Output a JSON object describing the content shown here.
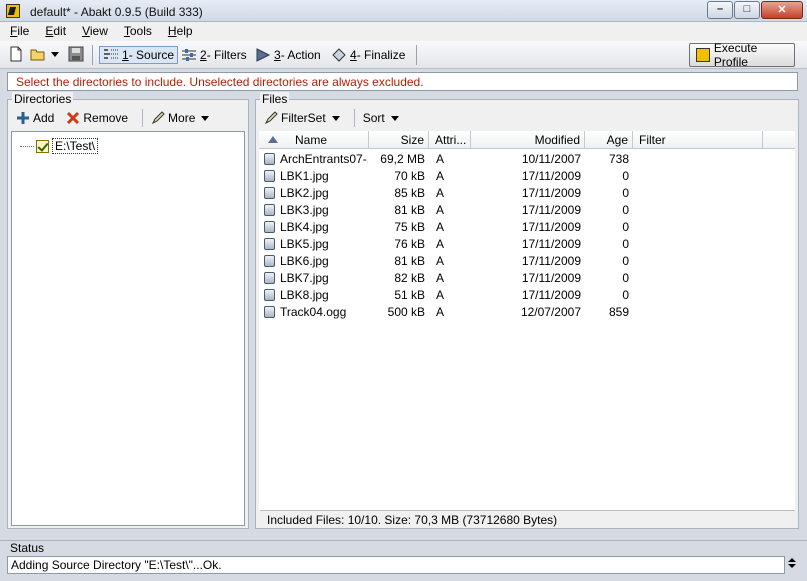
{
  "window": {
    "title": "default* - Abakt 0.9.5 (Build 333)",
    "minimize": "–",
    "maximize": "□",
    "close": "✕"
  },
  "menu": [
    "File",
    "Edit",
    "View",
    "Tools",
    "Help"
  ],
  "toolbar": {
    "steps": [
      {
        "num": "1",
        "label": " - Source"
      },
      {
        "num": "2",
        "label": " - Filters"
      },
      {
        "num": "3",
        "label": " - Action"
      },
      {
        "num": "4",
        "label": " - Finalize"
      }
    ],
    "execute_label": "Execute Profile"
  },
  "info": "Select the directories to include. Unselected directories are always excluded.",
  "directories": {
    "title": "Directories",
    "add": "Add",
    "remove": "Remove",
    "more": "More",
    "tree_item": "E:\\Test\\"
  },
  "files": {
    "title": "Files",
    "filterset": "FilterSet",
    "sort": "Sort",
    "columns": [
      "Name",
      "Size",
      "Attri...",
      "Modified",
      "Age",
      "Filter"
    ],
    "rows": [
      {
        "name": "ArchEntrants07-...",
        "size": "69,2 MB",
        "attr": "A",
        "modified": "10/11/2007",
        "age": "738"
      },
      {
        "name": "LBK1.jpg",
        "size": "70 kB",
        "attr": "A",
        "modified": "17/11/2009",
        "age": "0"
      },
      {
        "name": "LBK2.jpg",
        "size": "85 kB",
        "attr": "A",
        "modified": "17/11/2009",
        "age": "0"
      },
      {
        "name": "LBK3.jpg",
        "size": "81 kB",
        "attr": "A",
        "modified": "17/11/2009",
        "age": "0"
      },
      {
        "name": "LBK4.jpg",
        "size": "75 kB",
        "attr": "A",
        "modified": "17/11/2009",
        "age": "0"
      },
      {
        "name": "LBK5.jpg",
        "size": "76 kB",
        "attr": "A",
        "modified": "17/11/2009",
        "age": "0"
      },
      {
        "name": "LBK6.jpg",
        "size": "81 kB",
        "attr": "A",
        "modified": "17/11/2009",
        "age": "0"
      },
      {
        "name": "LBK7.jpg",
        "size": "82 kB",
        "attr": "A",
        "modified": "17/11/2009",
        "age": "0"
      },
      {
        "name": "LBK8.jpg",
        "size": "51 kB",
        "attr": "A",
        "modified": "17/11/2009",
        "age": "0"
      },
      {
        "name": "Track04.ogg",
        "size": "500 kB",
        "attr": "A",
        "modified": "12/07/2007",
        "age": "859"
      }
    ],
    "footer": "Included Files: 10/10. Size: 70,3 MB (73712680 Bytes)"
  },
  "status": {
    "title": "Status",
    "text": "Adding Source Directory \"E:\\Test\\\"...Ok."
  },
  "colors": {
    "info_text": "#b51d0a",
    "accent": "#f0c000"
  }
}
